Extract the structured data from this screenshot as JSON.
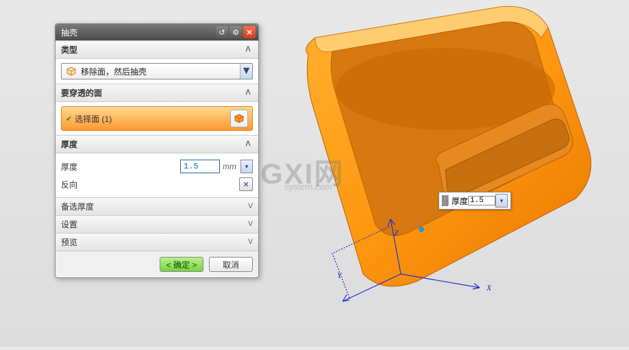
{
  "dialog": {
    "title": "抽壳",
    "sections": {
      "type": {
        "label": "类型",
        "dropdown": "移除面，然后抽壳"
      },
      "faces": {
        "label": "要穿透的面",
        "selected": "选择面 (1)"
      },
      "thickness": {
        "label": "厚度",
        "field_label": "厚度",
        "value": "1.5",
        "unit": "mm",
        "reverse_label": "反向"
      },
      "alt_thickness": {
        "label": "备选厚度"
      },
      "settings": {
        "label": "设置"
      },
      "preview": {
        "label": "预览"
      }
    },
    "buttons": {
      "ok": "< 确定 >",
      "cancel": "取消"
    }
  },
  "viewport": {
    "float_label": "厚度",
    "float_value": "1.5",
    "axes": {
      "x": "X",
      "y": "Y",
      "z": "Z"
    }
  },
  "watermark": {
    "line1": "GXI网",
    "line2": "system.com"
  }
}
